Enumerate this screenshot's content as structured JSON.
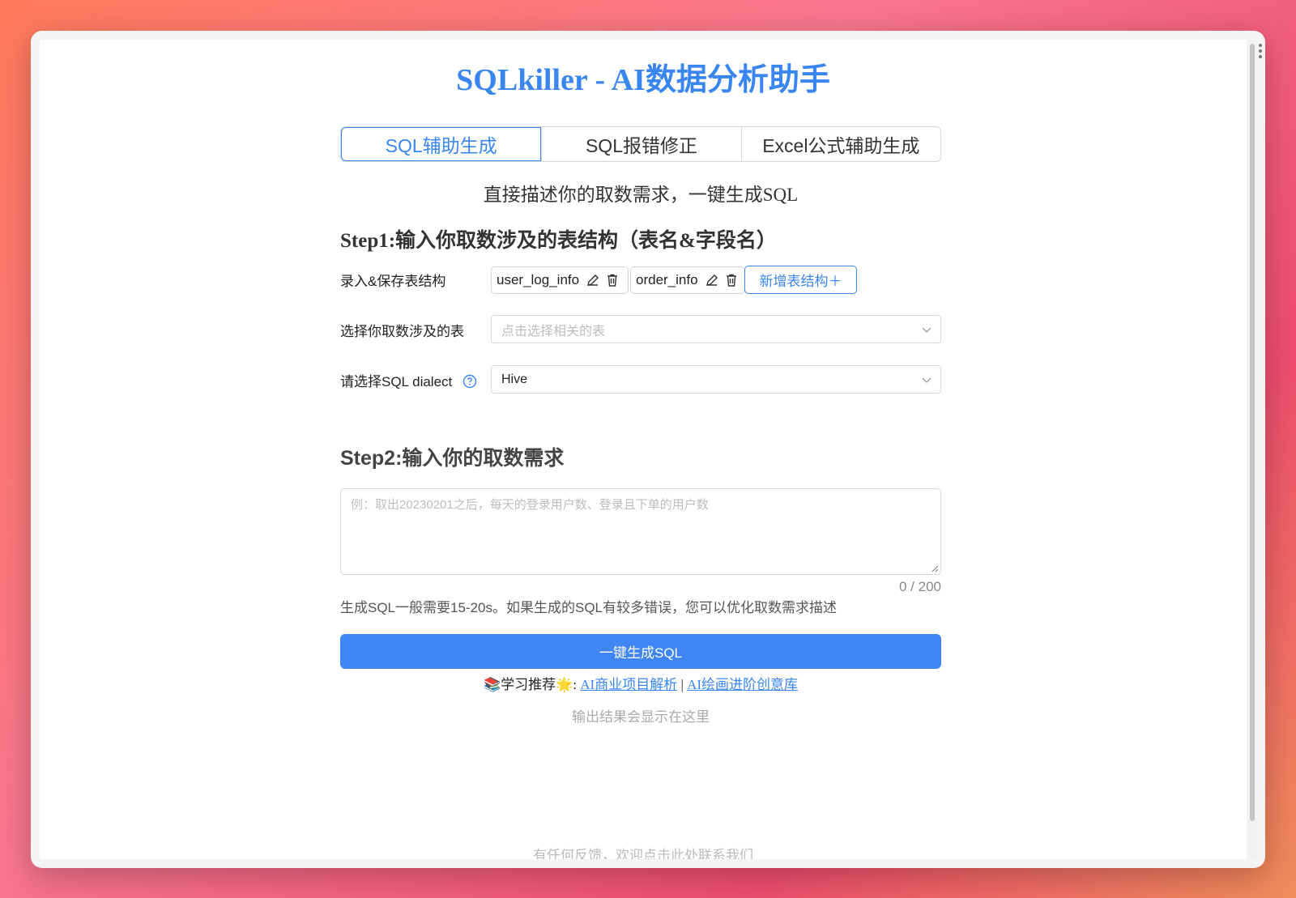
{
  "app": {
    "title": "SQLkiller - AI数据分析助手"
  },
  "tabs": [
    {
      "label": "SQL辅助生成",
      "active": true
    },
    {
      "label": "SQL报错修正",
      "active": false
    },
    {
      "label": "Excel公式辅助生成",
      "active": false
    }
  ],
  "subtitle": "直接描述你的取数需求，一键生成SQL",
  "step1": {
    "heading": "Step1:输入你取数涉及的表结构（表名&字段名）",
    "table_row_label": "录入&保存表结构",
    "tables": [
      "user_log_info",
      "order_info"
    ],
    "add_table_label": "新增表结构＋",
    "select_tables_label": "选择你取数涉及的表",
    "select_tables_placeholder": "点击选择相关的表",
    "dialect_label": "请选择SQL dialect",
    "dialect_value": "Hive"
  },
  "step2": {
    "heading": "Step2:输入你的取数需求",
    "placeholder": "例：取出20230201之后，每天的登录用户数、登录且下单的用户数",
    "counter": "0 / 200",
    "hint": "生成SQL一般需要15-20s。如果生成的SQL有较多错误，您可以优化取数需求描述",
    "generate_label": "一键生成SQL"
  },
  "recommend": {
    "prefix": "📚学习推荐🌟: ",
    "link1": "AI商业项目解析",
    "separator": " | ",
    "link2": "AI绘画进阶创意库"
  },
  "output_placeholder": "输出结果会显示在这里",
  "footer": "有任何反馈，欢迎点击此处联系我们",
  "colors": {
    "accent": "#3a86f0",
    "button": "#3f86f4"
  }
}
